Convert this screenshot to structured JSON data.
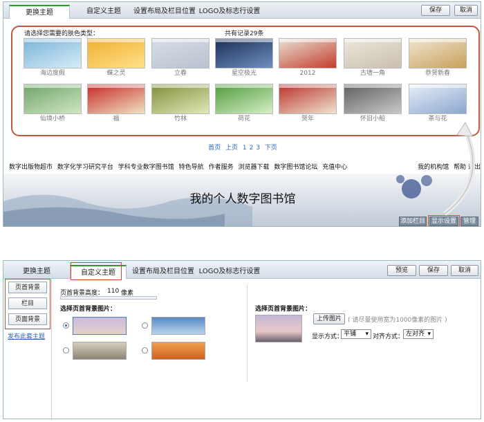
{
  "top": {
    "tabs": [
      "更换主题",
      "自定义主题",
      "设置布局及栏目位置",
      "LOGO及标志行设置"
    ],
    "save": "保存",
    "cancel": "取消",
    "prompt": "请选择您需要的肤色类型：",
    "record_count": "共有记录29条",
    "themes": [
      {
        "name": "海边度假",
        "colors": [
          "#7ab3d9",
          "#d6ecf7"
        ]
      },
      {
        "name": "蝶之灵",
        "colors": [
          "#f0b030",
          "#ffe08a"
        ]
      },
      {
        "name": "立春",
        "colors": [
          "#d7dde6",
          "#b8c2cf"
        ]
      },
      {
        "name": "星空极光",
        "colors": [
          "#1b2e55",
          "#6f8fc0"
        ]
      },
      {
        "name": "2012",
        "colors": [
          "#e8e2d6",
          "#c43d2b"
        ]
      },
      {
        "name": "古墙一角",
        "colors": [
          "#ece7dc",
          "#c9bfae"
        ]
      },
      {
        "name": "恭贺新春",
        "colors": [
          "#efe6d0",
          "#c9a05c"
        ]
      },
      {
        "name": "仙境小桥",
        "colors": [
          "#6fa36a",
          "#cfe6c3"
        ]
      },
      {
        "name": "福",
        "colors": [
          "#c62828",
          "#f1e2c0"
        ]
      },
      {
        "name": "竹林",
        "colors": [
          "#7e8f3a",
          "#e2e8b8"
        ]
      },
      {
        "name": "荷花",
        "colors": [
          "#4f9a3c",
          "#d6efc6"
        ]
      },
      {
        "name": "贺年",
        "colors": [
          "#b8322a",
          "#f0e3d0"
        ]
      },
      {
        "name": "怀旧小船",
        "colors": [
          "#5e5e5e",
          "#c9c9c9"
        ]
      },
      {
        "name": "茶与花",
        "colors": [
          "#e9eff7",
          "#8aa7cf"
        ]
      }
    ],
    "pager": [
      "首页",
      "上页",
      "1",
      "2",
      "3",
      "下页"
    ],
    "site_nav": [
      "数字出版物超市",
      "数字化学习研究平台",
      "学科专业数字图书馆",
      "特色导航",
      "作者服务",
      "浏览器下载",
      "数字图书馆论坛",
      "充值中心"
    ],
    "right_nav": [
      "我的机构馆",
      "帮助",
      "退出"
    ],
    "banner_title": "我的个人数字图书馆",
    "banner_buttons": [
      "添加栏目",
      "显示设置",
      "管理"
    ]
  },
  "bottom": {
    "tabs": [
      "更换主题",
      "自定义主题",
      "设置布局及栏目位置",
      "LOGO及标志行设置"
    ],
    "preview": "预览",
    "save": "保存",
    "cancel": "取消",
    "sidebar": [
      "页首背景",
      "栏目",
      "页面背景"
    ],
    "publish_link": "发布此套主题",
    "height_label": "页首背景高度：",
    "height_value": "110",
    "height_unit": "像素",
    "choose_label": "选择页首背景图片：",
    "right_choose_label": "选择页首背景图片：",
    "upload": "上传图片",
    "upload_hint": "( 请尽量使用宽为1000像素的图片 )",
    "display_label": "显示方式：",
    "display_value": "平铺",
    "align_label": "对齐方式：",
    "align_value": "左对齐"
  }
}
